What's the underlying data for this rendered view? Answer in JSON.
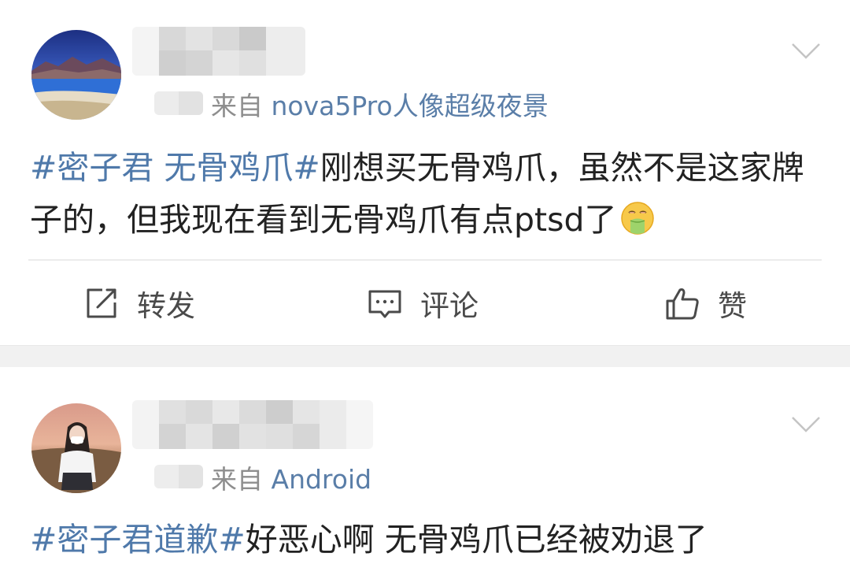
{
  "posts": [
    {
      "source_prefix": "来自 ",
      "source_device": "nova5Pro人像超级夜景",
      "text_tag": "#密子君 无骨鸡爪#",
      "text_body": "刚想买无骨鸡爪，虽然不是这家牌子的，但我现在看到无骨鸡爪有点ptsd了",
      "emoji": "vomiting-face-icon",
      "actions": {
        "repost": "转发",
        "comment": "评论",
        "like": "赞"
      }
    },
    {
      "source_prefix": "来自 ",
      "source_device": "Android",
      "text_tag": "#密子君道歉#",
      "text_body": "好恶心啊 无骨鸡爪已经被劝退了"
    }
  ],
  "colors": {
    "topic_link": "#4f79aa",
    "source_device": "#5a7ea8",
    "separator_band": "#f1f1f1"
  }
}
